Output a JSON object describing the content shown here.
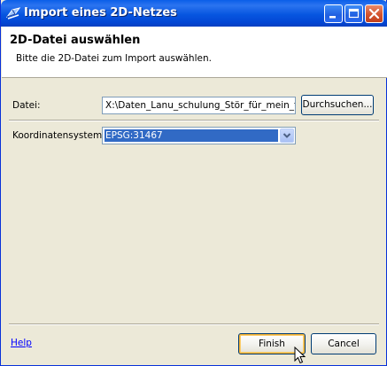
{
  "window": {
    "title": "Import eines 2D-Netzes"
  },
  "header": {
    "title": "2D-Datei auswählen",
    "description": "Bitte die 2D-Datei zum Import auswählen."
  },
  "form": {
    "file_label": "Datei:",
    "file_value": "X:\\Daten_Lanu_schulung_Stör_für_mein_te",
    "browse_label": "Durchsuchen...",
    "crs_label": "Koordinatensystem:",
    "crs_value": "EPSG:31467"
  },
  "footer": {
    "help_label": "Help",
    "finish_label": "Finish",
    "cancel_label": "Cancel"
  },
  "icons": {
    "app": "import-mesh-icon",
    "minimize": "minimize-icon",
    "maximize": "maximize-icon",
    "close": "close-icon",
    "dropdown": "chevron-down-icon",
    "cursor": "mouse-pointer-icon"
  },
  "colors": {
    "titlebar": "#0a5ee8",
    "window_bg": "#ece9d8",
    "selection": "#316ac5",
    "link": "#0000ff"
  }
}
